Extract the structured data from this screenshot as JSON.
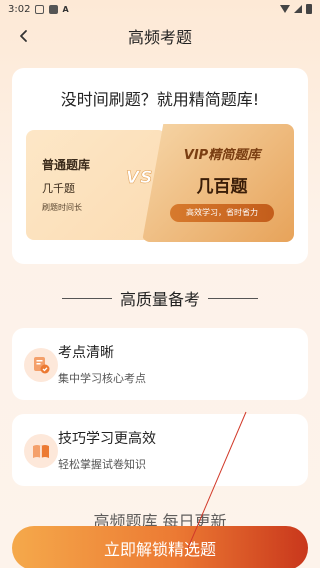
{
  "status_bar": {
    "time": "3:02",
    "app_letter": "A"
  },
  "nav": {
    "back_icon": "chevron-left-icon",
    "title": "高频考题"
  },
  "hero": {
    "headline": "没时间刷题？就用精简题库!",
    "basic": {
      "name": "普通题库",
      "count": "几千题",
      "note": "刷题时间长"
    },
    "vs": "VS",
    "vip": {
      "name": "VIP精简题库",
      "count": "几百题",
      "badge": "高效学习，省时省力"
    }
  },
  "section": {
    "title": "高质量备考"
  },
  "features": [
    {
      "icon": "document-check-icon",
      "title": "考点清晰",
      "desc": "集中学习核心考点"
    },
    {
      "icon": "book-icon",
      "title": "技巧学习更高效",
      "desc": "轻松掌握试卷知识"
    }
  ],
  "faded_heading": "高频题库   每日更新",
  "cta": {
    "label": "立即解锁精选题"
  },
  "colors": {
    "accent": "#ec7a33",
    "accent_dark": "#c9371c",
    "icon_bg": "#fde8da",
    "icon_fg": "#f08a4b"
  }
}
